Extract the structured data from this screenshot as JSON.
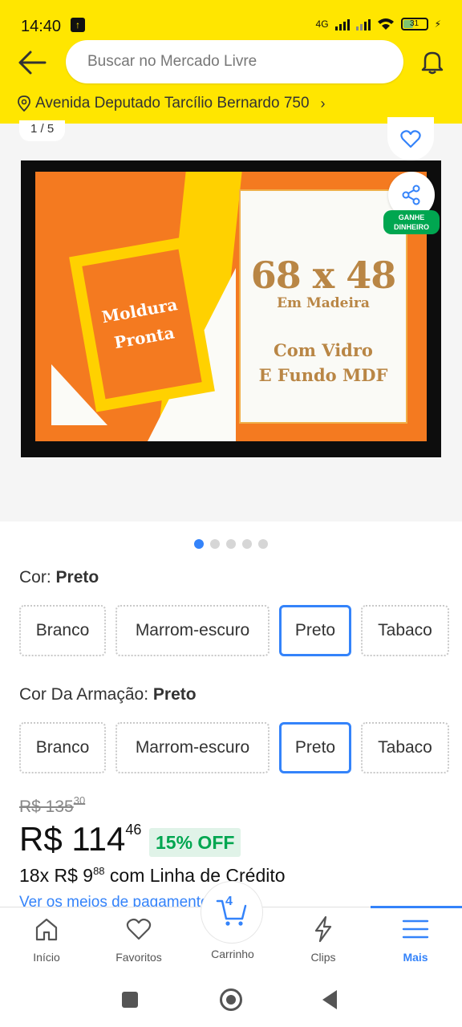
{
  "status_bar": {
    "time": "14:40",
    "network": "4G",
    "battery": "31"
  },
  "header": {
    "search_placeholder": "Buscar no Mercado Livre",
    "address": "Avenida Deputado Tarcílio Bernardo 750"
  },
  "gallery": {
    "counter": "1 / 5",
    "share_badge": "GANHE DINHEIRO",
    "image": {
      "frame_text_1": "Moldura",
      "frame_text_2": "Pronta",
      "size": "68 x 48",
      "material": "Em Madeira",
      "line1": "Com Vidro",
      "line2": "E Fundo MDF"
    },
    "dots": 5,
    "active_dot": 0
  },
  "variations": [
    {
      "label": "Cor:",
      "selected": "Preto",
      "options": [
        "Branco",
        "Marrom-escuro",
        "Preto",
        "Tabaco"
      ]
    },
    {
      "label": "Cor Da Armação:",
      "selected": "Preto",
      "options": [
        "Branco",
        "Marrom-escuro",
        "Preto",
        "Tabaco"
      ]
    }
  ],
  "price": {
    "old_int": "R$ 135",
    "old_cents": "30",
    "current_int": "R$ 114",
    "current_cents": "46",
    "discount": "15% OFF",
    "installments_prefix": "18x R$ 9",
    "installments_cents": "88",
    "installments_suffix": " com Linha de Crédito",
    "payment_link": "Ver os meios de pagamento"
  },
  "bottom_nav": {
    "items": [
      "Início",
      "Favoritos",
      "Carrinho",
      "Clips",
      "Mais"
    ],
    "cart_count": "4",
    "active": "Mais"
  },
  "colors": {
    "brand_yellow": "#ffe600",
    "accent_blue": "#3483fa",
    "success_green": "#00a650"
  }
}
